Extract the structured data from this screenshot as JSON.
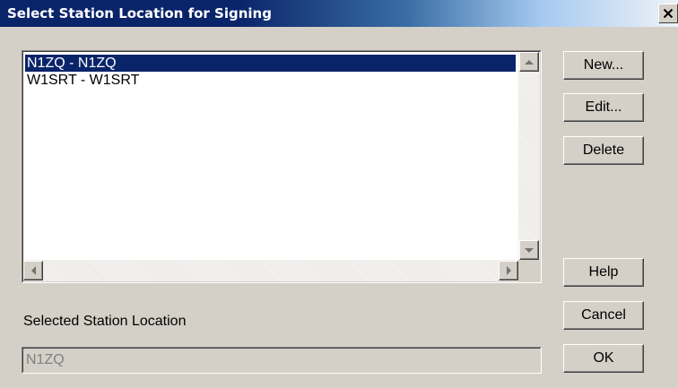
{
  "window": {
    "title": "Select Station Location for Signing",
    "close_glyph": "X"
  },
  "station_list": {
    "items": [
      {
        "label": "N1ZQ - N1ZQ",
        "selected": true
      },
      {
        "label": "W1SRT - W1SRT",
        "selected": false
      }
    ]
  },
  "buttons": {
    "new_label": "New...",
    "edit_label": "Edit...",
    "delete_label": "Delete",
    "help_label": "Help",
    "cancel_label": "Cancel",
    "ok_label": "OK"
  },
  "selected_location": {
    "label": "Selected Station Location",
    "value": "N1ZQ"
  },
  "icons": {
    "close": "close-icon",
    "scroll_up": "arrow-up-icon",
    "scroll_down": "arrow-down-icon",
    "scroll_left": "arrow-left-icon",
    "scroll_right": "arrow-right-icon"
  },
  "colors": {
    "selection": "#0a246a",
    "face": "#d4d0c8"
  }
}
